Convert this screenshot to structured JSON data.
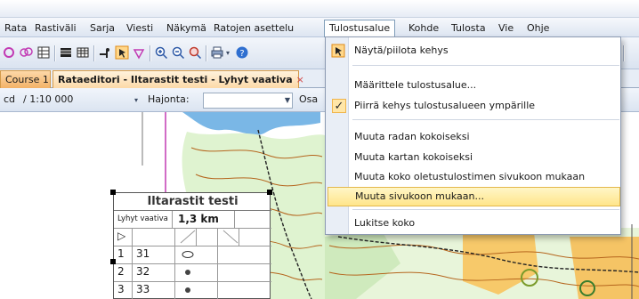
{
  "menubar": {
    "items": [
      "Rata",
      "Rastiväli",
      "Sarja",
      "Viesti",
      "Näkymä",
      "Ratojen asettelu",
      "Tulostusalue",
      "Kohde",
      "Tulosta",
      "Vie",
      "Ohje"
    ],
    "active_index": 6
  },
  "toolbar": {
    "icons": [
      "control-icon",
      "multi-control-icon",
      "description-table-icon",
      "fill-area-icon",
      "grid-icon",
      "line-icon",
      "print-area-icon",
      "rotate-icon",
      "zoom-in-icon",
      "zoom-out-icon",
      "move-icon",
      "print-icon",
      "help-icon"
    ]
  },
  "tabs": [
    {
      "label": "Course 1",
      "closable": false
    },
    {
      "label": "Rataeditori - Iltarastit testi - Lyhyt vaativa",
      "closable": true
    }
  ],
  "toolbar2": {
    "scale_prefix": "cd",
    "scale_value": "/ 1:10 000",
    "spread_label": "Hajonta:",
    "spread_value": "",
    "part_label": "Osa"
  },
  "dropdown": {
    "items": [
      {
        "label": "Näytä/piilota kehys",
        "icon": "print-area-icon",
        "checked": false
      },
      {
        "label": "Määrittele tulostusalue...",
        "icon": "",
        "checked": false
      },
      {
        "label": "Piirrä kehys tulostusalueen ympärille",
        "icon": "",
        "checked": true
      },
      {
        "label": "Muuta radan kokoiseksi",
        "icon": "",
        "checked": false
      },
      {
        "label": "Muuta kartan kokoiseksi",
        "icon": "",
        "checked": false
      },
      {
        "label": "Muuta koko oletustulostimen sivukoon mukaan",
        "icon": "",
        "checked": false
      },
      {
        "label": "Muuta sivukoon mukaan...",
        "icon": "",
        "checked": false,
        "highlighted": true
      },
      {
        "label": "Lukitse koko",
        "icon": "",
        "checked": false
      }
    ]
  },
  "legend": {
    "title": "Iltarastit testi",
    "course": "Lyhyt vaativa",
    "length": "1,3 km",
    "rows": [
      {
        "num": "1",
        "code": "31",
        "symbol": "ellipse"
      },
      {
        "num": "2",
        "code": "32",
        "symbol": "dot"
      },
      {
        "num": "3",
        "code": "33",
        "symbol": "dot"
      }
    ]
  },
  "colors": {
    "menu_highlight": "#ffe58a",
    "tab_active": "#fcd9a8",
    "tab_close": "#d24a4a",
    "map_water": "#7ab7e6",
    "map_forest_light": "#d7f2c6",
    "map_field": "#f7c96a"
  }
}
